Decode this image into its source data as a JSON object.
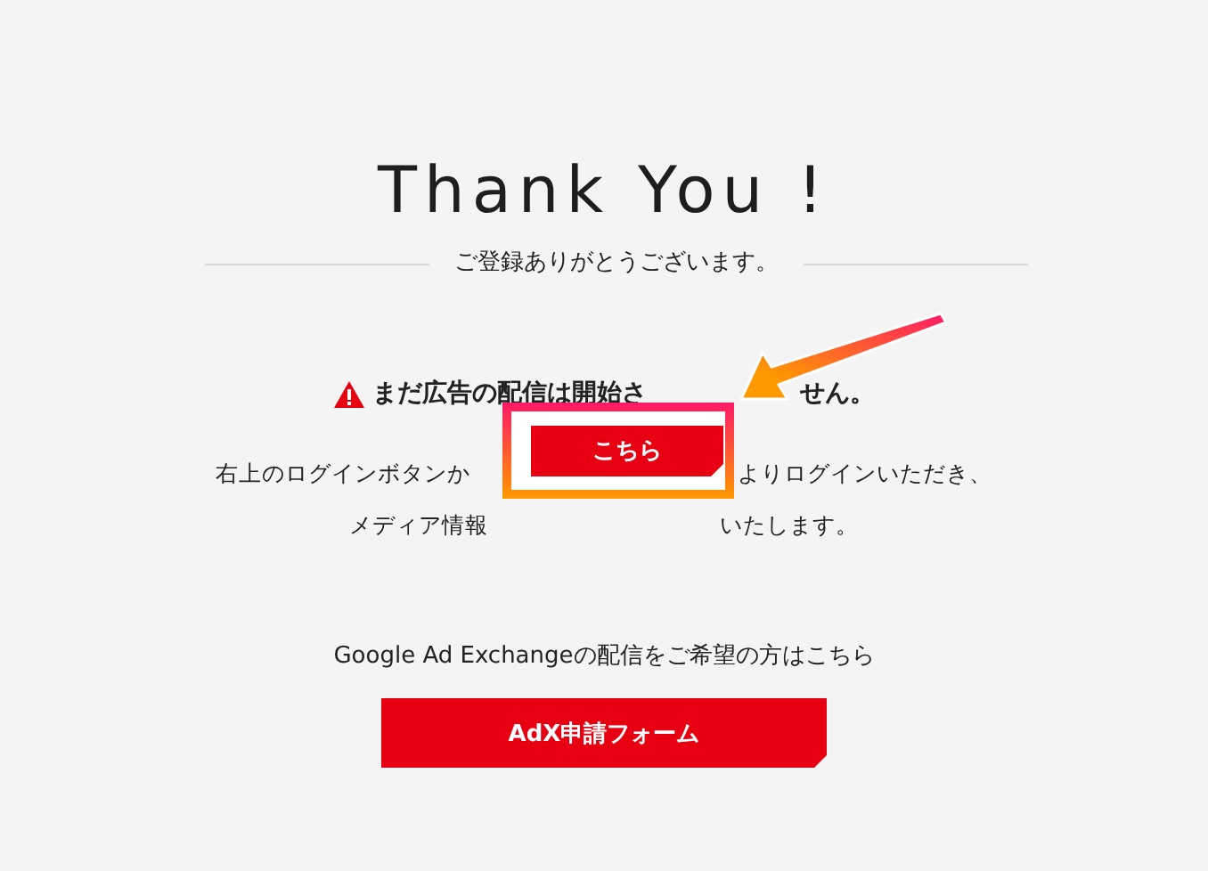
{
  "title": "Thank You !",
  "subtitle": "ご登録ありがとうございます。",
  "notice": {
    "warning": [
      "まだ広告の配信は開始さ",
      "せん。"
    ],
    "lines": [
      [
        "右上のログインボタンか",
        "よりログインいただき、"
      ],
      [
        "メディア情報",
        "いたします。"
      ]
    ]
  },
  "callout": {
    "button": "こちら"
  },
  "adx": {
    "text": "Google Ad Exchangeの配信をご希望の方はこちら",
    "button": "AdX申請フォーム"
  }
}
